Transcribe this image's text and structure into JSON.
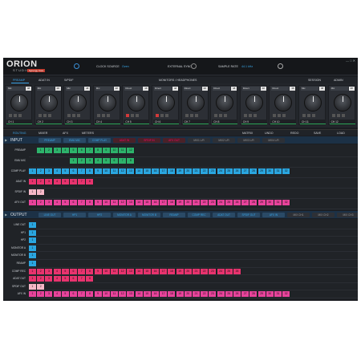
{
  "app": {
    "logo": "ORION",
    "logo_sub": "STUDIO",
    "sync_badge": "Synergy Core"
  },
  "header": {
    "clock_label": "CLOCK SOURCE",
    "clock_value": "Oven",
    "ext_label": "EXTERNAL SYNC",
    "rate_label": "SAMPLE RATE",
    "rate_value": "44.1 kHz",
    "win_controls": "— □ ✕"
  },
  "tabs": [
    "PREAMP",
    "ADAT IN",
    "S/PDIF",
    "MONITORS / HEADPHONES",
    "SESSION",
    "ADMIN"
  ],
  "channels": [
    {
      "input": "Mic",
      "name": "CH 1",
      "led": false
    },
    {
      "input": "Mic",
      "name": "CH 2",
      "led": false
    },
    {
      "input": "Mic",
      "name": "CH 3",
      "led": false
    },
    {
      "input": "Mic",
      "name": "CH 4",
      "led": false
    },
    {
      "input": "Direct",
      "name": "CH 5",
      "led": true
    },
    {
      "input": "Direct",
      "name": "CH 6",
      "led": true
    },
    {
      "input": "Direct",
      "name": "CH 7",
      "led": false
    },
    {
      "input": "Direct",
      "name": "CH 8",
      "led": false
    },
    {
      "input": "Direct",
      "name": "CH 9",
      "led": false
    },
    {
      "input": "Direct",
      "name": "CH 10",
      "led": false
    },
    {
      "input": "Mic",
      "name": "CH 11",
      "led": false
    },
    {
      "input": "Mic",
      "name": "CH 12",
      "led": false
    }
  ],
  "subtabs": [
    "ROUTING",
    "MIXER",
    "AFX",
    "METERS",
    "MATRIX",
    "UNDO",
    "REDO",
    "SAVE",
    "LOAD"
  ],
  "input": {
    "title": "INPUT",
    "buttons": [
      "PREAMP",
      "EMU MIC",
      "COMP PLAY",
      "ADAT IN",
      "SPDIF IN",
      "AFX OUT",
      "MIX1 L/R",
      "MIX2 L/R",
      "MIX3 L/R",
      "MIX4 L/R"
    ],
    "rows": [
      {
        "label": "PREAMP",
        "color": "#2db36b",
        "start": 1,
        "count": 12
      },
      {
        "label": "EMU MIC",
        "color": "#2db36b",
        "start": 5,
        "count": 8
      },
      {
        "label": "COMP PLAY",
        "color": "#2aa6e0",
        "start": 0,
        "count": 32
      },
      {
        "label": "ADAT IN",
        "color": "#e8336e",
        "start": 0,
        "count": 8
      },
      {
        "label": "SPDIF IN",
        "color": "#f7b8c8",
        "start": 0,
        "count": 2
      },
      {
        "label": "AFX OUT",
        "color": "#e8439b",
        "start": 0,
        "count": 32
      }
    ]
  },
  "output": {
    "title": "OUTPUT",
    "buttons": [
      "LINE OUT",
      "HP1",
      "HP2",
      "MONITOR A",
      "MONITOR B",
      "REAMP",
      "COMP REC",
      "ADAT OUT",
      "SPDIF OUT",
      "AFX IN",
      "MIX CH1",
      "MIX CH2",
      "MIX CH3",
      "MIX CH4"
    ],
    "rows": [
      {
        "label": "LINE OUT",
        "color": "#2aa6e0",
        "start": 0,
        "count": 1
      },
      {
        "label": "HP1",
        "color": "#2aa6e0",
        "start": 0,
        "count": 1
      },
      {
        "label": "HP2",
        "color": "#2aa6e0",
        "start": 0,
        "count": 1
      },
      {
        "label": "MONITOR A",
        "color": "#2aa6e0",
        "start": 0,
        "count": 1
      },
      {
        "label": "MONITOR B",
        "color": "#2aa6e0",
        "start": 0,
        "count": 1
      },
      {
        "label": "REAMP",
        "color": "#2aa6e0",
        "start": 0,
        "count": 1
      },
      {
        "label": "COMP REC",
        "color": "#e8336e",
        "start": 0,
        "count": 26
      },
      {
        "label": "ADAT OUT",
        "color": "#e8336e",
        "start": 0,
        "count": 8
      },
      {
        "label": "SPDIF OUT",
        "color": "#f7b8c8",
        "start": 0,
        "count": 2
      },
      {
        "label": "AFX IN",
        "color": "#e8439b",
        "start": 0,
        "count": 32
      }
    ]
  }
}
